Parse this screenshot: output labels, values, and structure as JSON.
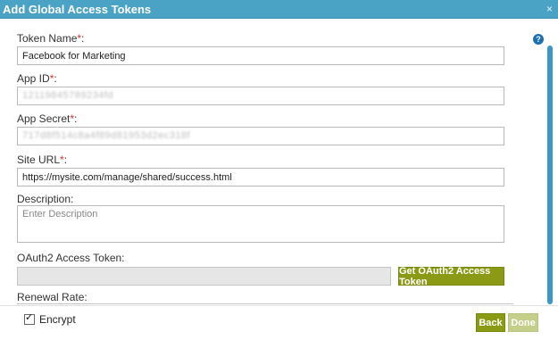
{
  "dialog": {
    "title": "Add Global Access Tokens",
    "close_icon": "×",
    "help_icon": "?"
  },
  "form": {
    "token_name": {
      "label": "Token Name",
      "required": "*",
      "colon": ":",
      "value": "Facebook for Marketing"
    },
    "app_id": {
      "label": "App ID",
      "required": "*",
      "colon": ":",
      "value": "12119845789234fd"
    },
    "app_secret": {
      "label": "App Secret",
      "required": "*",
      "colon": ":",
      "value": "717d8f514c8a4f89d81953d2ec318f"
    },
    "site_url": {
      "label": "Site URL",
      "required": "*",
      "colon": ":",
      "value": "https://mysite.com/manage/shared/success.html"
    },
    "description": {
      "label": "Description:",
      "placeholder": "Enter Description",
      "value": ""
    },
    "oauth_token": {
      "label": "OAuth2 Access Token:",
      "value": "",
      "button": "Get OAuth2 Access Token"
    },
    "renewal_rate": {
      "label": "Renewal Rate:"
    }
  },
  "footer": {
    "encrypt_label": "Encrypt",
    "encrypt_checked": true,
    "back_label": "Back",
    "done_label": "Done"
  },
  "colors": {
    "title_bar": "#4aa3c4",
    "button_green": "#8a9a15",
    "button_disabled": "#c5cf8a",
    "required": "#d0312d"
  }
}
